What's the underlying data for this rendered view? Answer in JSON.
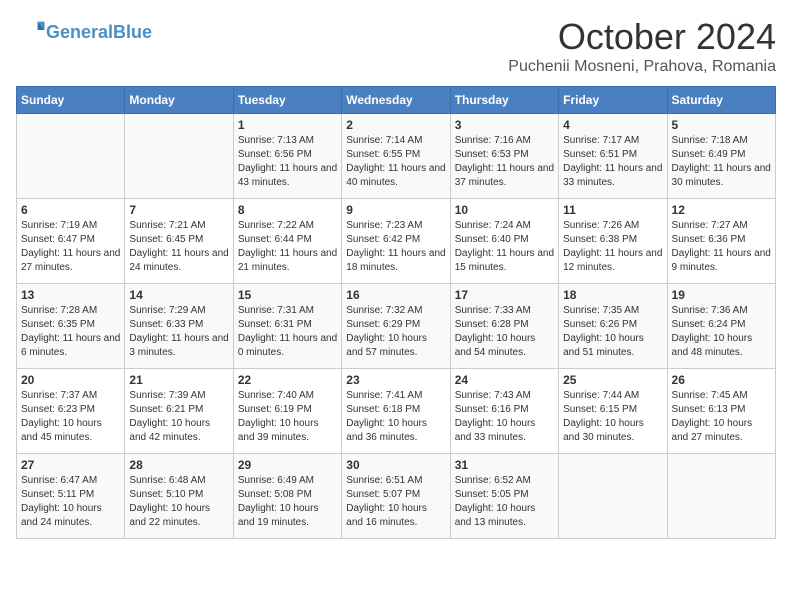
{
  "header": {
    "logo_text_general": "General",
    "logo_text_blue": "Blue",
    "month": "October 2024",
    "location": "Puchenii Mosneni, Prahova, Romania"
  },
  "days_of_week": [
    "Sunday",
    "Monday",
    "Tuesday",
    "Wednesday",
    "Thursday",
    "Friday",
    "Saturday"
  ],
  "weeks": [
    [
      {
        "day": "",
        "info": ""
      },
      {
        "day": "",
        "info": ""
      },
      {
        "day": "1",
        "info": "Sunrise: 7:13 AM\nSunset: 6:56 PM\nDaylight: 11 hours and 43 minutes."
      },
      {
        "day": "2",
        "info": "Sunrise: 7:14 AM\nSunset: 6:55 PM\nDaylight: 11 hours and 40 minutes."
      },
      {
        "day": "3",
        "info": "Sunrise: 7:16 AM\nSunset: 6:53 PM\nDaylight: 11 hours and 37 minutes."
      },
      {
        "day": "4",
        "info": "Sunrise: 7:17 AM\nSunset: 6:51 PM\nDaylight: 11 hours and 33 minutes."
      },
      {
        "day": "5",
        "info": "Sunrise: 7:18 AM\nSunset: 6:49 PM\nDaylight: 11 hours and 30 minutes."
      }
    ],
    [
      {
        "day": "6",
        "info": "Sunrise: 7:19 AM\nSunset: 6:47 PM\nDaylight: 11 hours and 27 minutes."
      },
      {
        "day": "7",
        "info": "Sunrise: 7:21 AM\nSunset: 6:45 PM\nDaylight: 11 hours and 24 minutes."
      },
      {
        "day": "8",
        "info": "Sunrise: 7:22 AM\nSunset: 6:44 PM\nDaylight: 11 hours and 21 minutes."
      },
      {
        "day": "9",
        "info": "Sunrise: 7:23 AM\nSunset: 6:42 PM\nDaylight: 11 hours and 18 minutes."
      },
      {
        "day": "10",
        "info": "Sunrise: 7:24 AM\nSunset: 6:40 PM\nDaylight: 11 hours and 15 minutes."
      },
      {
        "day": "11",
        "info": "Sunrise: 7:26 AM\nSunset: 6:38 PM\nDaylight: 11 hours and 12 minutes."
      },
      {
        "day": "12",
        "info": "Sunrise: 7:27 AM\nSunset: 6:36 PM\nDaylight: 11 hours and 9 minutes."
      }
    ],
    [
      {
        "day": "13",
        "info": "Sunrise: 7:28 AM\nSunset: 6:35 PM\nDaylight: 11 hours and 6 minutes."
      },
      {
        "day": "14",
        "info": "Sunrise: 7:29 AM\nSunset: 6:33 PM\nDaylight: 11 hours and 3 minutes."
      },
      {
        "day": "15",
        "info": "Sunrise: 7:31 AM\nSunset: 6:31 PM\nDaylight: 11 hours and 0 minutes."
      },
      {
        "day": "16",
        "info": "Sunrise: 7:32 AM\nSunset: 6:29 PM\nDaylight: 10 hours and 57 minutes."
      },
      {
        "day": "17",
        "info": "Sunrise: 7:33 AM\nSunset: 6:28 PM\nDaylight: 10 hours and 54 minutes."
      },
      {
        "day": "18",
        "info": "Sunrise: 7:35 AM\nSunset: 6:26 PM\nDaylight: 10 hours and 51 minutes."
      },
      {
        "day": "19",
        "info": "Sunrise: 7:36 AM\nSunset: 6:24 PM\nDaylight: 10 hours and 48 minutes."
      }
    ],
    [
      {
        "day": "20",
        "info": "Sunrise: 7:37 AM\nSunset: 6:23 PM\nDaylight: 10 hours and 45 minutes."
      },
      {
        "day": "21",
        "info": "Sunrise: 7:39 AM\nSunset: 6:21 PM\nDaylight: 10 hours and 42 minutes."
      },
      {
        "day": "22",
        "info": "Sunrise: 7:40 AM\nSunset: 6:19 PM\nDaylight: 10 hours and 39 minutes."
      },
      {
        "day": "23",
        "info": "Sunrise: 7:41 AM\nSunset: 6:18 PM\nDaylight: 10 hours and 36 minutes."
      },
      {
        "day": "24",
        "info": "Sunrise: 7:43 AM\nSunset: 6:16 PM\nDaylight: 10 hours and 33 minutes."
      },
      {
        "day": "25",
        "info": "Sunrise: 7:44 AM\nSunset: 6:15 PM\nDaylight: 10 hours and 30 minutes."
      },
      {
        "day": "26",
        "info": "Sunrise: 7:45 AM\nSunset: 6:13 PM\nDaylight: 10 hours and 27 minutes."
      }
    ],
    [
      {
        "day": "27",
        "info": "Sunrise: 6:47 AM\nSunset: 5:11 PM\nDaylight: 10 hours and 24 minutes."
      },
      {
        "day": "28",
        "info": "Sunrise: 6:48 AM\nSunset: 5:10 PM\nDaylight: 10 hours and 22 minutes."
      },
      {
        "day": "29",
        "info": "Sunrise: 6:49 AM\nSunset: 5:08 PM\nDaylight: 10 hours and 19 minutes."
      },
      {
        "day": "30",
        "info": "Sunrise: 6:51 AM\nSunset: 5:07 PM\nDaylight: 10 hours and 16 minutes."
      },
      {
        "day": "31",
        "info": "Sunrise: 6:52 AM\nSunset: 5:05 PM\nDaylight: 10 hours and 13 minutes."
      },
      {
        "day": "",
        "info": ""
      },
      {
        "day": "",
        "info": ""
      }
    ]
  ]
}
